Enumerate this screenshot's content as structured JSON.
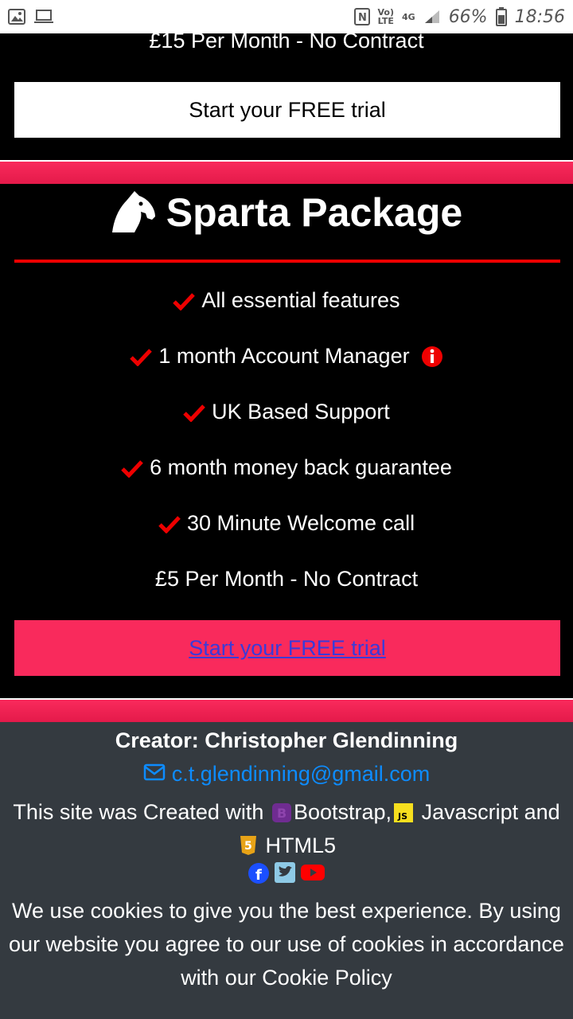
{
  "status_bar": {
    "network_label_1": "Vo)",
    "network_label_2": "LTE",
    "network_type": "4G",
    "battery": "66%",
    "time": "18:56",
    "icons": [
      "image-icon",
      "laptop-icon",
      "nfc-icon",
      "signal-icon",
      "battery-icon"
    ]
  },
  "prev_package": {
    "price": "£15 Per Month - No Contract",
    "cta": "Start your FREE trial"
  },
  "sparta_package": {
    "title": "Sparta Package",
    "icon": "horse-head-icon",
    "features": [
      "All essential features",
      "1 month Account Manager",
      "UK Based Support",
      "6 month money back guarantee",
      "30 Minute Welcome call"
    ],
    "price": "£5 Per Month - No Contract",
    "cta": "Start your FREE trial"
  },
  "footer": {
    "creator": "Creator: Christopher Glendinning",
    "email": "c.t.glendinning@gmail.com",
    "made_with_prefix": "This site was Created with",
    "bootstrap": "Bootstrap,",
    "javascript": "Javascript and",
    "html5": "HTML5",
    "cookie_notice": "We use cookies to give you the best experience. By using our website you agree to our use of cookies in accordance with our Cookie Policy"
  },
  "colors": {
    "accent_pink": "#f92a5c",
    "check_red": "#e00000",
    "footer_bg": "#343a40",
    "link_blue": "#0d8cff"
  }
}
